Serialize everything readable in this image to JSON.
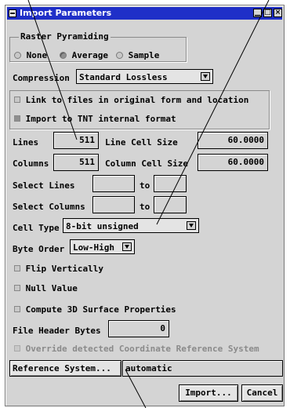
{
  "window": {
    "title": "Import Parameters"
  },
  "pyramiding": {
    "label": "Raster Pyramiding",
    "options": [
      "None",
      "Average",
      "Sample"
    ],
    "selected": "Average"
  },
  "compression": {
    "label": "Compression",
    "value": "Standard Lossless"
  },
  "mode": {
    "link_label": "Link to files in original form and location",
    "import_label": "Import to TNT internal format",
    "selected": "Import to TNT internal format"
  },
  "lines": {
    "label": "Lines",
    "value": "511",
    "cell_size_label": "Line Cell Size",
    "cell_size": "60.0000"
  },
  "columns": {
    "label": "Columns",
    "value": "511",
    "cell_size_label": "Column Cell Size",
    "cell_size": "60.0000"
  },
  "select_lines": {
    "label": "Select Lines",
    "to_label": "to",
    "from": "",
    "to": ""
  },
  "select_columns": {
    "label": "Select Columns",
    "to_label": "to",
    "from": "",
    "to": ""
  },
  "cell_type": {
    "label": "Cell Type",
    "value": "8-bit unsigned"
  },
  "byte_order": {
    "label": "Byte Order",
    "value": "Low-High"
  },
  "checks": {
    "flip": "Flip Vertically",
    "null": "Null Value",
    "surface": "Compute 3D Surface Properties",
    "override": "Override detected Coordinate Reference System"
  },
  "header_bytes": {
    "label": "File Header Bytes",
    "value": "0"
  },
  "reference": {
    "button": "Reference System...",
    "value": "automatic"
  },
  "actions": {
    "import": "Import...",
    "cancel": "Cancel"
  }
}
